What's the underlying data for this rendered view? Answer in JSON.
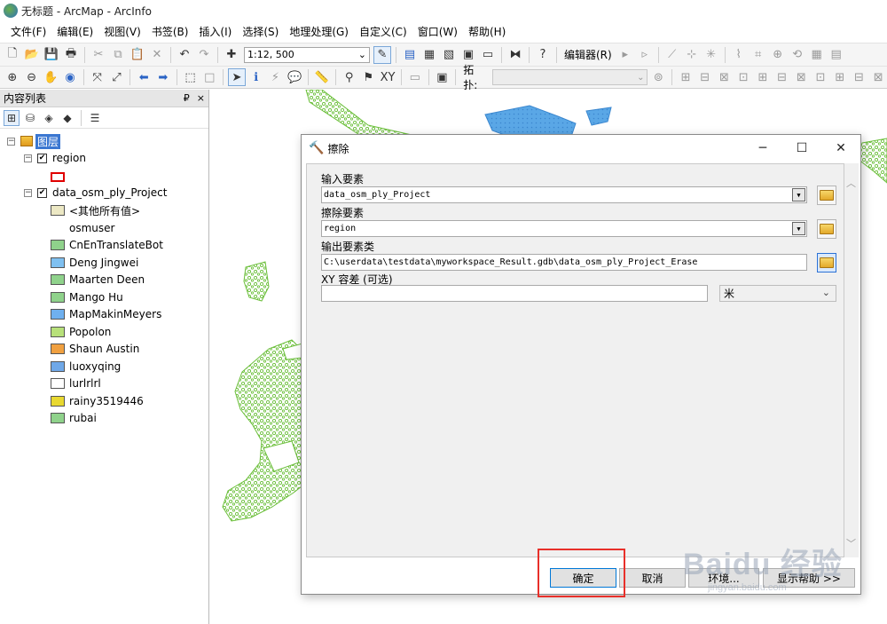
{
  "window": {
    "title": "无标题 - ArcMap - ArcInfo"
  },
  "menu": [
    "文件(F)",
    "编辑(E)",
    "视图(V)",
    "书签(B)",
    "插入(I)",
    "选择(S)",
    "地理处理(G)",
    "自定义(C)",
    "窗口(W)",
    "帮助(H)"
  ],
  "toolbar": {
    "scale": "1:12, 500",
    "editor_label": "编辑器(R)",
    "topology_label": "拓扑:"
  },
  "toc": {
    "title": "内容列表",
    "pin": "₽",
    "close": "×",
    "root": "图层",
    "layers": [
      {
        "name": "region",
        "checked": true
      },
      {
        "name": "data_osm_ply_Project",
        "checked": true
      }
    ],
    "classes": [
      {
        "label": "<其他所有值>",
        "color": "#ece8c4"
      },
      {
        "label": "osmuser",
        "color": ""
      },
      {
        "label": "CnEnTranslateBot",
        "color": "#8fd28b"
      },
      {
        "label": "Deng Jingwei",
        "color": "#7fc0f0"
      },
      {
        "label": "Maarten Deen",
        "color": "#8fd28b"
      },
      {
        "label": "Mango Hu",
        "color": "#8fd28b"
      },
      {
        "label": "MapMakinMeyers",
        "color": "#6fb0ef"
      },
      {
        "label": "Popolon",
        "color": "#b7e07a"
      },
      {
        "label": "Shaun Austin",
        "color": "#f0a040"
      },
      {
        "label": "luoxyqing",
        "color": "#6fa8e8"
      },
      {
        "label": "lurlrlrl",
        "color": "#ffffff"
      },
      {
        "label": "rainy3519446",
        "color": "#e8d830"
      },
      {
        "label": "rubai",
        "color": "#8fd28b"
      }
    ]
  },
  "dialog": {
    "title": "擦除",
    "fields": [
      {
        "label": "输入要素",
        "value": "data_osm_ply_Project"
      },
      {
        "label": "擦除要素",
        "value": "region"
      },
      {
        "label": "输出要素类",
        "value": "C:\\userdata\\testdata\\myworkspace_Result.gdb\\data_osm_ply_Project_Erase"
      },
      {
        "label": "XY 容差 (可选)",
        "value": ""
      }
    ],
    "unit": "米",
    "buttons": {
      "ok": "确定",
      "cancel": "取消",
      "env": "环境...",
      "help": "显示帮助 >>"
    }
  },
  "watermark": {
    "main": "Baidu 经验",
    "sub": "jingyan.baidu.com"
  },
  "colors": {
    "accent_red": "#e8302a",
    "map_green": "#6bbf3a",
    "map_blue": "#5aa7e6"
  }
}
